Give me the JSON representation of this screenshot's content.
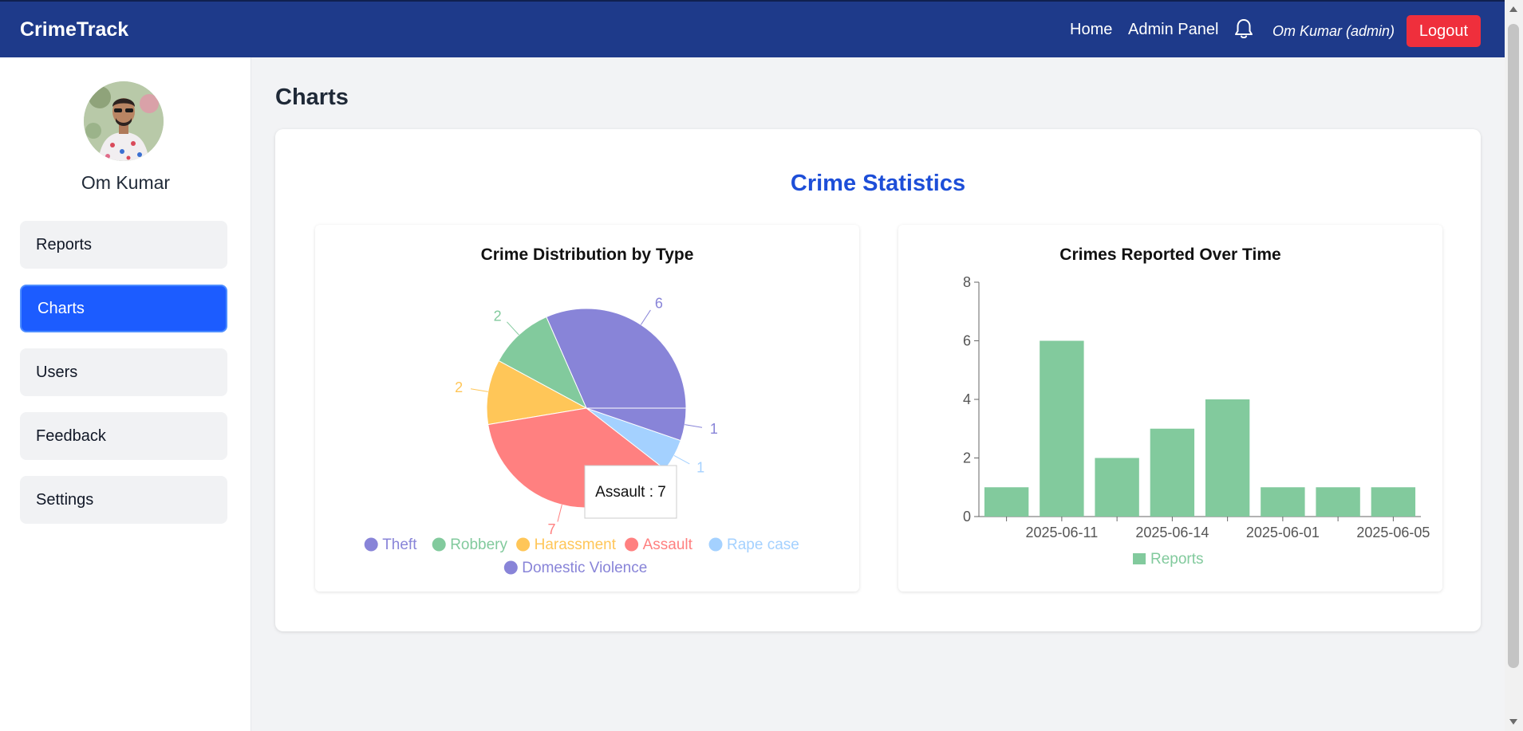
{
  "navbar": {
    "brand": "CrimeTrack",
    "links": [
      "Home",
      "Admin Panel"
    ],
    "user": "Om Kumar (admin)",
    "logout_label": "Logout",
    "bell_icon": "bell-icon",
    "bg_color": "#1e3a8a",
    "logout_color": "#ef2f3c"
  },
  "sidebar": {
    "profile_name": "Om Kumar",
    "items": [
      {
        "label": "Reports",
        "active": false
      },
      {
        "label": "Charts",
        "active": true
      },
      {
        "label": "Users",
        "active": false
      },
      {
        "label": "Feedback",
        "active": false
      },
      {
        "label": "Settings",
        "active": false
      }
    ],
    "accent": "#1c5cff"
  },
  "main": {
    "page_title": "Charts",
    "section_title": "Crime Statistics"
  },
  "chart_data": [
    {
      "type": "pie",
      "title": "Crime Distribution by Type",
      "slices": [
        {
          "label": "Theft",
          "value": 6,
          "color": "#8884d8"
        },
        {
          "label": "Robbery",
          "value": 2,
          "color": "#82ca9d"
        },
        {
          "label": "Harassment",
          "value": 2,
          "color": "#ffc658"
        },
        {
          "label": "Assault",
          "value": 7,
          "color": "#ff8080"
        },
        {
          "label": "Rape case",
          "value": 1,
          "color": "#a4d1ff"
        },
        {
          "label": "Domestic Violence",
          "value": 1,
          "color": "#8884d8"
        }
      ],
      "tooltip": "Assault : 7",
      "legend": "bottom"
    },
    {
      "type": "bar",
      "title": "Crimes Reported Over Time",
      "categories": [
        "",
        "2025-06-11",
        "",
        "2025-06-14",
        "",
        "2025-06-01",
        "",
        "2025-06-05"
      ],
      "series": [
        {
          "name": "Reports",
          "values": [
            1,
            6,
            2,
            3,
            4,
            1,
            1,
            1
          ],
          "color": "#82ca9d"
        }
      ],
      "yticks": [
        0,
        2,
        4,
        6,
        8
      ],
      "ylim": [
        0,
        8
      ],
      "legend": "bottom"
    }
  ]
}
